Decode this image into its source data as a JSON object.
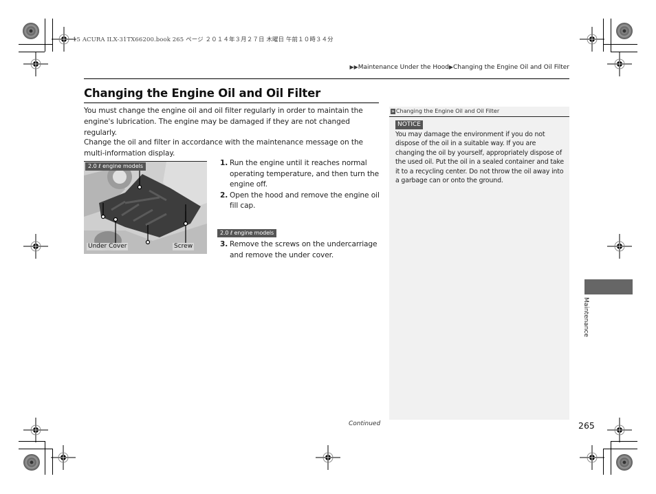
{
  "print_header": {
    "text": "15 ACURA ILX-31TX66200.book  265 ページ  ２０１４年３月２７日  木曜日  午前１０時３４分"
  },
  "breadcrumb": {
    "arrow_icon": "▶▶",
    "items": [
      "Maintenance Under the Hood",
      "Changing the Engine Oil and Oil Filter"
    ],
    "separator_icon": "▶"
  },
  "section": {
    "title": "Changing the Engine Oil and Oil Filter",
    "paragraphs": [
      "You must change the engine oil and oil filter regularly in order to maintain the engine's lubrication. The engine may be damaged if they are not changed regularly.",
      "Change the oil and filter in accordance with the maintenance message on the multi-information display."
    ]
  },
  "figure": {
    "tag": "2.0 ℓ engine models",
    "labels": {
      "under_cover": "Under Cover",
      "screw": "Screw"
    }
  },
  "steps": [
    {
      "num": "1.",
      "text": "Run the engine until it reaches normal operating temperature, and then turn the engine off."
    },
    {
      "num": "2.",
      "text": "Open the hood and remove the engine oil fill cap."
    },
    {
      "num": "3.",
      "tag": "2.0 ℓ engine models",
      "text": "Remove the screws on the undercarriage and remove the under cover."
    }
  ],
  "sidebar": {
    "ref_icon": "»",
    "heading": "Changing the Engine Oil and Oil Filter",
    "notice_label": "NOTICE",
    "notice_text": "You may damage the environment if you do not dispose of the oil in a suitable way. If you are changing the oil by yourself, appropriately dispose of the used oil. Put the oil in a sealed container and take it to a recycling center. Do not throw the oil away into a garbage can or onto the ground."
  },
  "section_tab": {
    "label": "Maintenance"
  },
  "footer": {
    "continued": "Continued",
    "page_number": "265"
  }
}
